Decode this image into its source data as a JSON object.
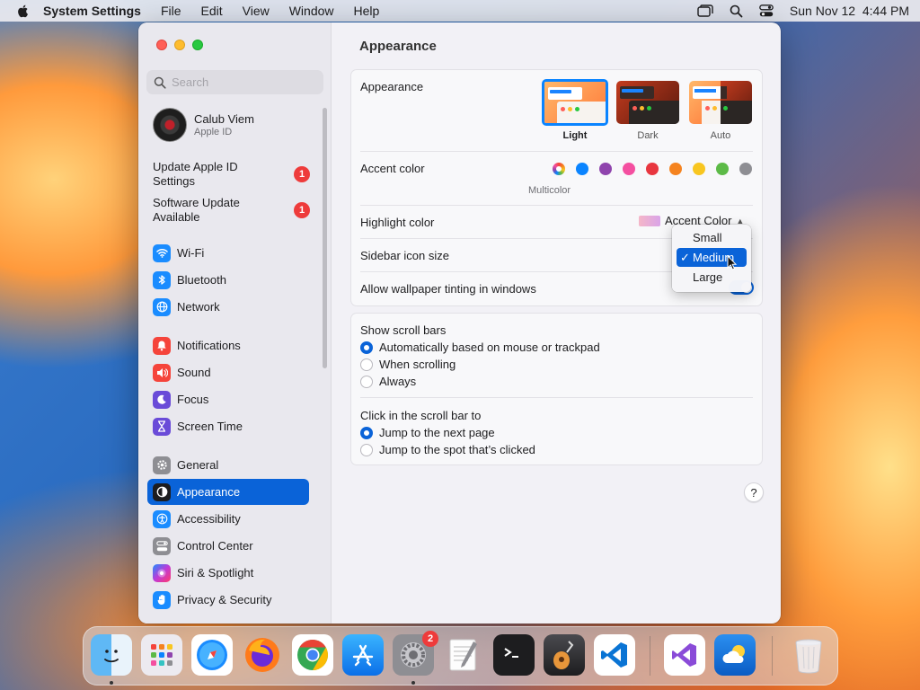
{
  "menubar": {
    "app_name": "System Settings",
    "items": [
      "File",
      "Edit",
      "View",
      "Window",
      "Help"
    ],
    "datetime": "Sun Nov 12  4:44 PM"
  },
  "sidebar": {
    "search_placeholder": "Search",
    "profile": {
      "name": "Calub Viem",
      "subtitle": "Apple ID"
    },
    "notices": [
      {
        "label": "Update Apple ID Settings",
        "badge": "1"
      },
      {
        "label": "Software Update Available",
        "badge": "1"
      }
    ],
    "items": [
      {
        "label": "Wi-Fi",
        "icon": "wifi-icon",
        "color": "#1a8cff"
      },
      {
        "label": "Bluetooth",
        "icon": "bluetooth-icon",
        "color": "#1a8cff"
      },
      {
        "label": "Network",
        "icon": "globe-icon",
        "color": "#1a8cff"
      },
      {
        "label": "Notifications",
        "icon": "bell-icon",
        "color": "#f5443b"
      },
      {
        "label": "Sound",
        "icon": "speaker-icon",
        "color": "#f5443b"
      },
      {
        "label": "Focus",
        "icon": "moon-icon",
        "color": "#6a4bd8"
      },
      {
        "label": "Screen Time",
        "icon": "hourglass-icon",
        "color": "#6a4bd8"
      },
      {
        "label": "General",
        "icon": "gear-icon",
        "color": "#8e8e93"
      },
      {
        "label": "Appearance",
        "icon": "appearance-icon",
        "color": "#1d1d1f"
      },
      {
        "label": "Accessibility",
        "icon": "accessibility-icon",
        "color": "#1a8cff"
      },
      {
        "label": "Control Center",
        "icon": "control-center-icon",
        "color": "#8e8e93"
      },
      {
        "label": "Siri & Spotlight",
        "icon": "siri-icon",
        "color": "#c13ad6"
      },
      {
        "label": "Privacy & Security",
        "icon": "hand-icon",
        "color": "#1a8cff"
      }
    ],
    "active": "Appearance"
  },
  "main": {
    "title": "Appearance",
    "appearance": {
      "label": "Appearance",
      "options": [
        "Light",
        "Dark",
        "Auto"
      ],
      "selected": "Light"
    },
    "accent": {
      "label": "Accent color",
      "caption": "Multicolor",
      "colors": [
        "#0a84ff",
        "#8f44ad",
        "#f44fa0",
        "#e8363f",
        "#f5831f",
        "#f8c620",
        "#5cba47",
        "#8e8e93"
      ]
    },
    "highlight": {
      "label": "Highlight color",
      "value": "Accent Color"
    },
    "sidebar_icon_size": {
      "label": "Sidebar icon size",
      "options": [
        "Small",
        "Medium",
        "Large"
      ],
      "selected": "Medium"
    },
    "wallpaper_tinting": {
      "label": "Allow wallpaper tinting in windows"
    },
    "scroll_bars": {
      "label": "Show scroll bars",
      "options": [
        "Automatically based on mouse or trackpad",
        "When scrolling",
        "Always"
      ],
      "selected": 0
    },
    "click_scroll": {
      "label": "Click in the scroll bar to",
      "options": [
        "Jump to the next page",
        "Jump to the spot that’s clicked"
      ],
      "selected": 0
    },
    "help": "?"
  },
  "dock": {
    "settings_badge": "2"
  }
}
